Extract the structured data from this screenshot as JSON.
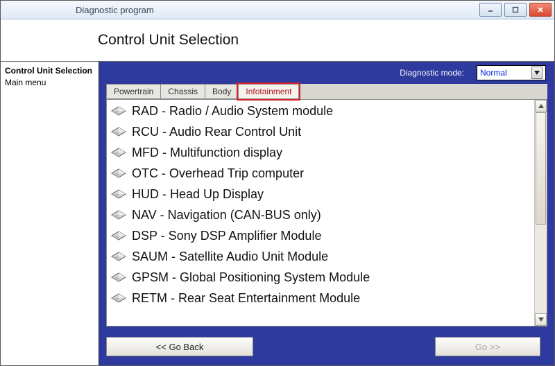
{
  "window": {
    "title": "Diagnostic program"
  },
  "header": {
    "page_title": "Control Unit Selection"
  },
  "sidebar": {
    "items": [
      {
        "label": "Control Unit Selection",
        "bold": true
      },
      {
        "label": "Main menu",
        "bold": false
      }
    ]
  },
  "diagnostic_mode": {
    "label": "Diagnostic mode:",
    "value": "Normal"
  },
  "tabs": [
    {
      "label": "Powertrain",
      "active": false,
      "highlight": false
    },
    {
      "label": "Chassis",
      "active": false,
      "highlight": false
    },
    {
      "label": "Body",
      "active": false,
      "highlight": false
    },
    {
      "label": "Infotainment",
      "active": true,
      "highlight": true
    }
  ],
  "modules": [
    {
      "label": "RAD - Radio / Audio System module"
    },
    {
      "label": "RCU - Audio Rear Control Unit"
    },
    {
      "label": "MFD - Multifunction display"
    },
    {
      "label": "OTC - Overhead Trip computer"
    },
    {
      "label": "HUD - Head Up Display"
    },
    {
      "label": "NAV - Navigation (CAN-BUS only)"
    },
    {
      "label": "DSP - Sony DSP Amplifier Module"
    },
    {
      "label": "SAUM - Satellite Audio Unit Module"
    },
    {
      "label": "GPSM - Global Positioning System Module"
    },
    {
      "label": "RETM - Rear Seat Entertainment Module"
    }
  ],
  "footer": {
    "back": "<< Go Back",
    "go": "Go >>"
  }
}
